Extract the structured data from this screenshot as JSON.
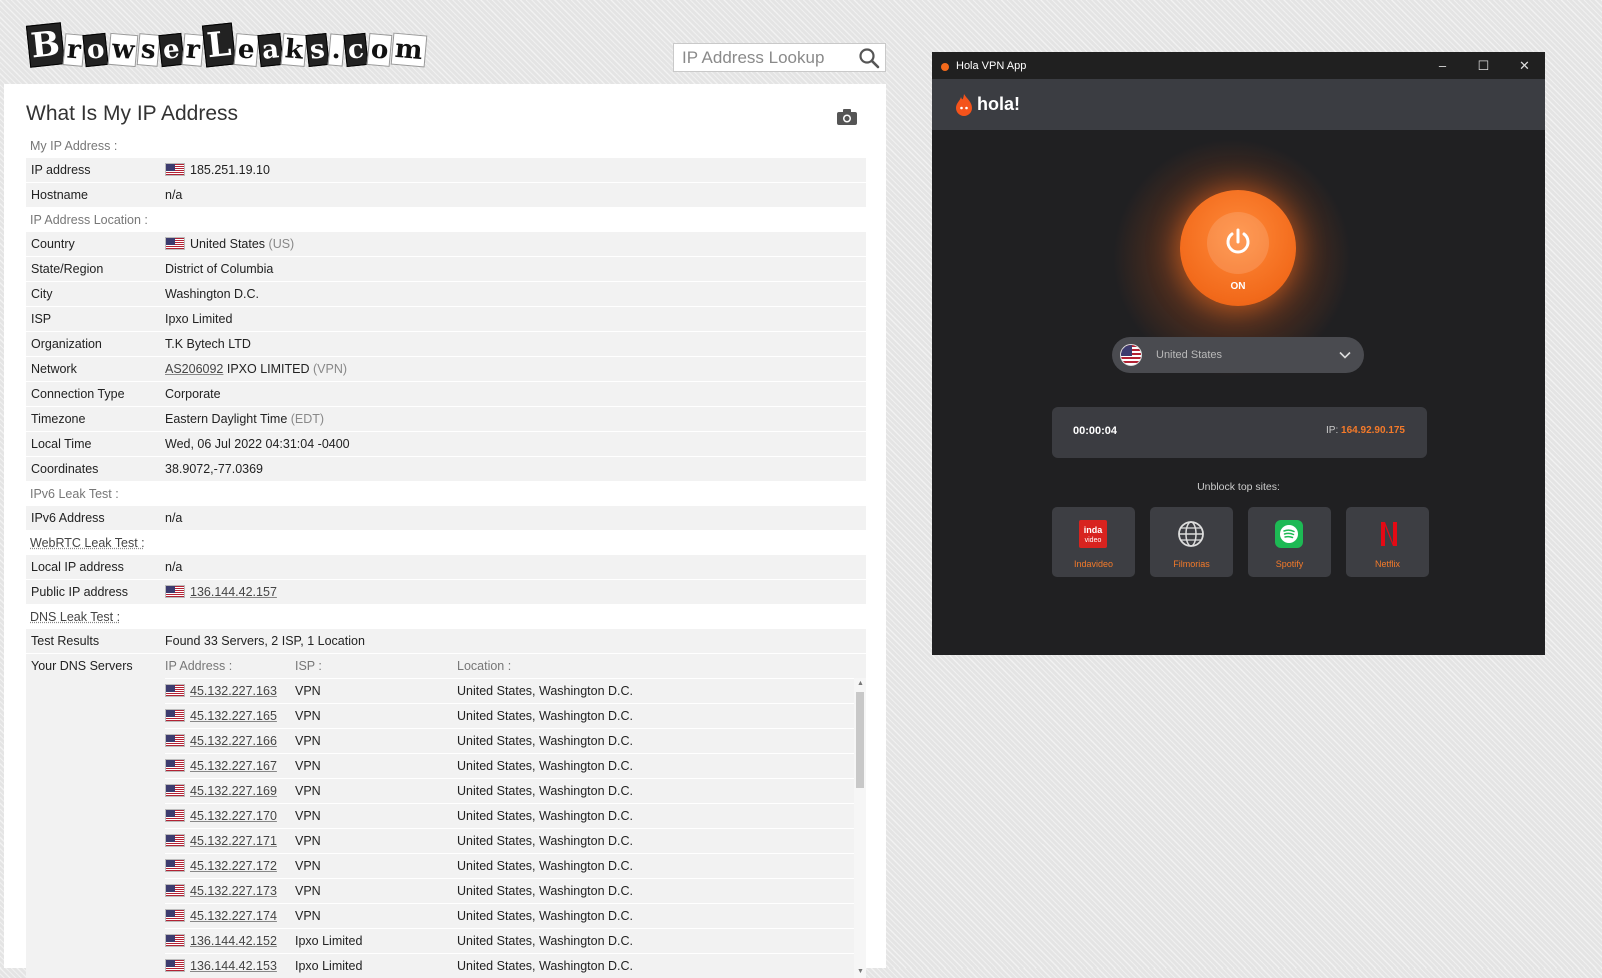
{
  "site": {
    "logo": [
      "B",
      "r",
      "o",
      "w",
      "s",
      "e",
      "r",
      "L",
      "e",
      "a",
      "k",
      "s",
      ".",
      "c",
      "o",
      "m"
    ],
    "search_placeholder": "IP Address Lookup",
    "page_title": "What Is My IP Address"
  },
  "sections": {
    "my_ip": "My IP Address :",
    "location": "IP Address Location :",
    "ipv6": "IPv6 Leak Test :",
    "webrtc": "WebRTC Leak Test :",
    "dns": "DNS Leak Test :"
  },
  "my_ip": {
    "ip_label": "IP address",
    "ip_value": "185.251.19.10",
    "host_label": "Hostname",
    "host_value": "n/a"
  },
  "location": {
    "country_label": "Country",
    "country_value": "United States",
    "country_code": "(US)",
    "state_label": "State/Region",
    "state_value": "District of Columbia",
    "city_label": "City",
    "city_value": "Washington D.C.",
    "isp_label": "ISP",
    "isp_value": "Ipxo Limited",
    "org_label": "Organization",
    "org_value": "T.K Bytech LTD",
    "net_label": "Network",
    "net_as": "AS206092",
    "net_name": "IPXO LIMITED",
    "net_type": "(VPN)",
    "conn_label": "Connection Type",
    "conn_value": "Corporate",
    "tz_label": "Timezone",
    "tz_value": "Eastern Daylight Time",
    "tz_abbr": "(EDT)",
    "lt_label": "Local Time",
    "lt_value": "Wed, 06 Jul 2022 04:31:04 -0400",
    "coord_label": "Coordinates",
    "coord_value": "38.9072,-77.0369"
  },
  "ipv6": {
    "label": "IPv6 Address",
    "value": "n/a"
  },
  "webrtc": {
    "local_label": "Local IP address",
    "local_value": "n/a",
    "public_label": "Public IP address",
    "public_value": "136.144.42.157"
  },
  "dns": {
    "results_label": "Test Results",
    "results_value": "Found 33 Servers, 2 ISP, 1 Location",
    "servers_label": "Your DNS Servers",
    "col_ip": "IP Address :",
    "col_isp": "ISP :",
    "col_loc": "Location :",
    "rows": [
      {
        "ip": "45.132.227.163",
        "isp": "VPN",
        "loc": "United States, Washington D.C."
      },
      {
        "ip": "45.132.227.165",
        "isp": "VPN",
        "loc": "United States, Washington D.C."
      },
      {
        "ip": "45.132.227.166",
        "isp": "VPN",
        "loc": "United States, Washington D.C."
      },
      {
        "ip": "45.132.227.167",
        "isp": "VPN",
        "loc": "United States, Washington D.C."
      },
      {
        "ip": "45.132.227.169",
        "isp": "VPN",
        "loc": "United States, Washington D.C."
      },
      {
        "ip": "45.132.227.170",
        "isp": "VPN",
        "loc": "United States, Washington D.C."
      },
      {
        "ip": "45.132.227.171",
        "isp": "VPN",
        "loc": "United States, Washington D.C."
      },
      {
        "ip": "45.132.227.172",
        "isp": "VPN",
        "loc": "United States, Washington D.C."
      },
      {
        "ip": "45.132.227.173",
        "isp": "VPN",
        "loc": "United States, Washington D.C."
      },
      {
        "ip": "45.132.227.174",
        "isp": "VPN",
        "loc": "United States, Washington D.C."
      },
      {
        "ip": "136.144.42.152",
        "isp": "Ipxo Limited",
        "loc": "United States, Washington D.C."
      },
      {
        "ip": "136.144.42.153",
        "isp": "Ipxo Limited",
        "loc": "United States, Washington D.C."
      }
    ]
  },
  "hola": {
    "window_title": "Hola VPN App",
    "brand": "hola!",
    "power_state": "ON",
    "country": "United States",
    "timer": "00:00:04",
    "ip_label": "IP:",
    "ip_value": "164.92.90.175",
    "unblock_title": "Unblock top sites:",
    "sites": [
      "Indavideo",
      "Filmorias",
      "Spotify",
      "Netflix"
    ],
    "accent": "#f47a2a"
  }
}
